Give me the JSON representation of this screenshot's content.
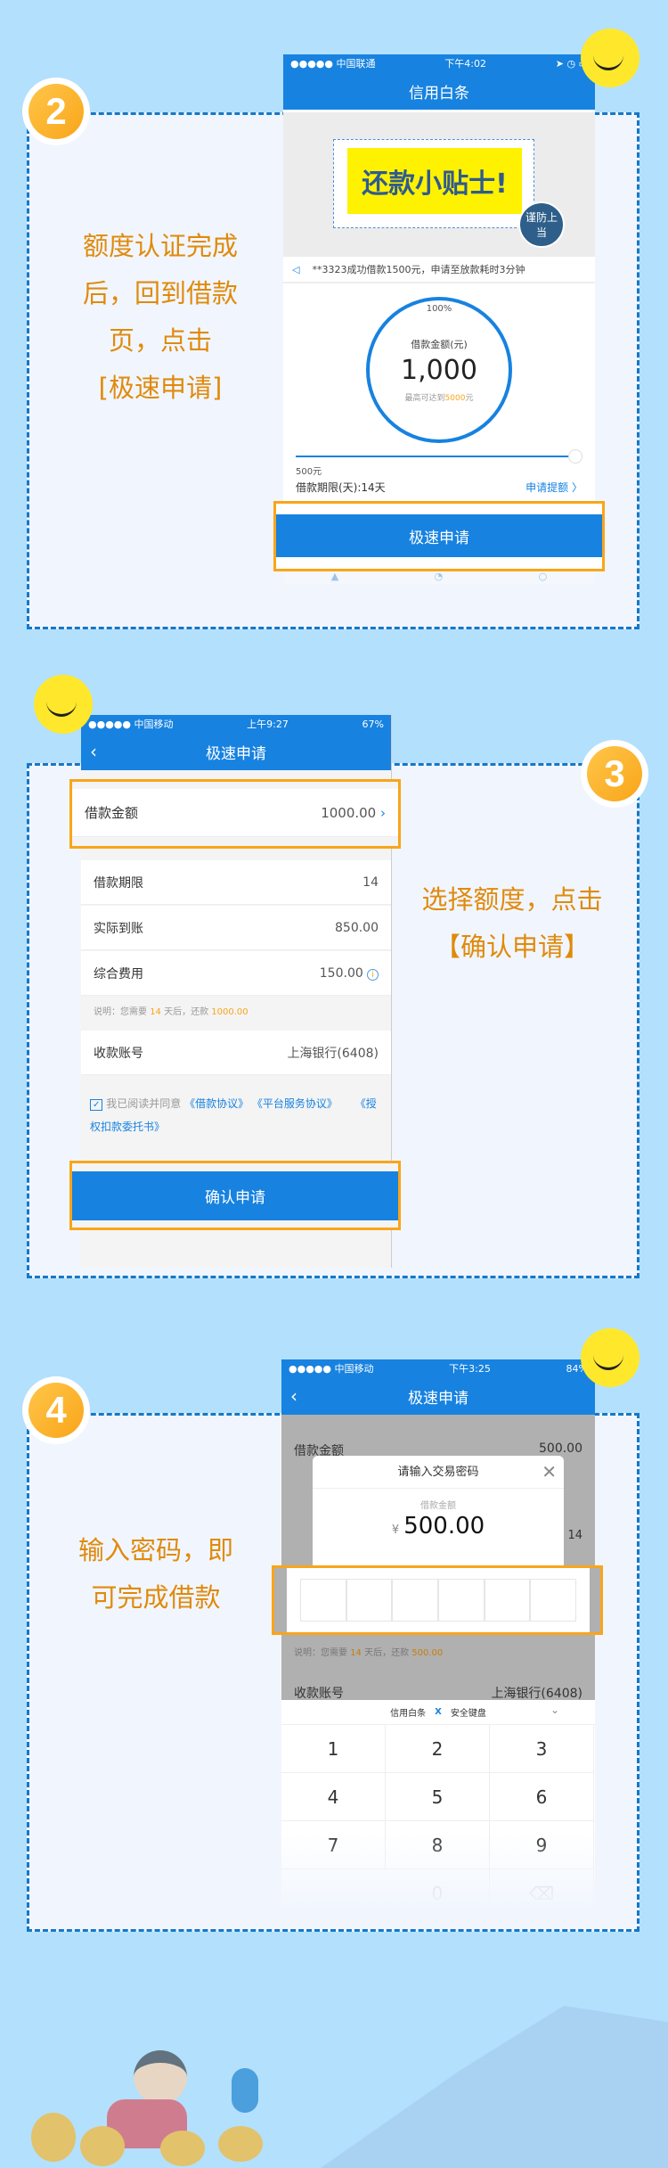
{
  "steps": [
    {
      "number": "2",
      "lines": [
        "额度认证完成",
        "后，回到借款",
        "页，点击",
        "[极速申请]"
      ]
    },
    {
      "number": "3",
      "lines": [
        "选择额度，点击",
        "【确认申请】"
      ]
    },
    {
      "number": "4",
      "lines": [
        "输入密码，即",
        "可完成借款"
      ]
    }
  ],
  "screen1": {
    "status": {
      "carrier": "●●●●● 中国联通",
      "time": "下午4:02"
    },
    "title": "信用白条",
    "banner": {
      "headline": "还款小贴士!",
      "badge": "谨防上当"
    },
    "notice": "**3323成功借款1500元，申请至放款耗时3分钟",
    "gauge": {
      "percent_label": "100%",
      "label": "借款金额(元)",
      "amount": "1,000",
      "max_prefix": "最高可达到",
      "max_value": "5000",
      "max_suffix": "元",
      "progress": 1.0
    },
    "slider_min": "500元",
    "term": "借款期限(天):14天",
    "raise_limit": "申请提额 〉",
    "apply_button": "极速申请"
  },
  "screen2": {
    "status": {
      "carrier": "●●●●● 中国移动",
      "time": "上午9:27",
      "battery": "67%"
    },
    "title": "极速申请",
    "rows": [
      {
        "label": "借款金额",
        "value": "1000.00"
      },
      {
        "label": "借款期限",
        "value": "14"
      },
      {
        "label": "实际到账",
        "value": "850.00"
      },
      {
        "label": "综合费用",
        "value": "150.00"
      }
    ],
    "note": {
      "prefix": "说明：您需要 ",
      "days": "14",
      "mid": " 天后，还款 ",
      "amount": "1000.00"
    },
    "account": {
      "label": "收款账号",
      "value": "上海银行(6408)"
    },
    "agree": {
      "text": "我已阅读并同意",
      "links": [
        "《借款协议》",
        "《平台服务协议》",
        "《授权扣款委托书》"
      ]
    },
    "confirm_button": "确认申请"
  },
  "screen3": {
    "status": {
      "carrier": "●●●●● 中国移动",
      "time": "下午3:25",
      "battery": "84%"
    },
    "title": "极速申请",
    "bg_rows": [
      {
        "label": "借款金额",
        "value": "500.00"
      },
      {
        "label": "说明",
        "value": ""
      },
      {
        "label": "借款期限",
        "value": "14"
      }
    ],
    "note": {
      "prefix": "说明：您需要 ",
      "days": "14",
      "mid": " 天后，还款 ",
      "amount": "500.00"
    },
    "account": {
      "label": "收款账号",
      "value": "上海银行(6408)"
    },
    "modal": {
      "title": "请输入交易密码",
      "amount_label": "借款金额",
      "currency": "¥",
      "amount": "500.00"
    },
    "keyboard": {
      "brand": "信用白条",
      "title": "安全键盘",
      "keys": [
        "1",
        "2",
        "3",
        "4",
        "5",
        "6",
        "7",
        "8",
        "9",
        "",
        "0",
        "⌫"
      ]
    }
  },
  "colors": {
    "accent": "#1782e0",
    "highlight": "#f9a51a",
    "step_text": "#e08a0c",
    "background": "#b3e0fd"
  }
}
